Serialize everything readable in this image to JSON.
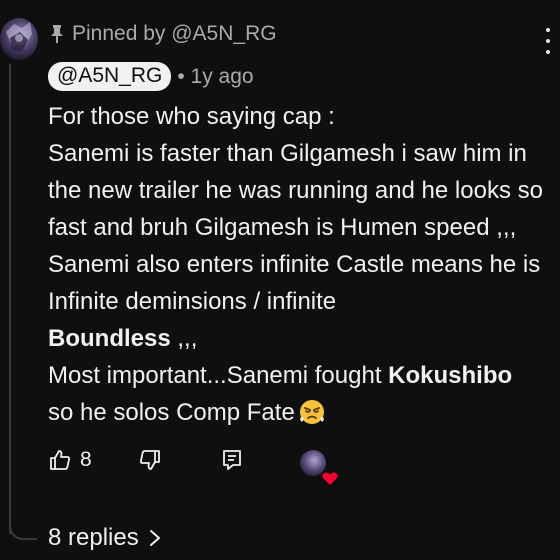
{
  "pinned": {
    "label": "Pinned by @A5N_RG",
    "icon": "pin-icon"
  },
  "comment": {
    "author": "@A5N_RG",
    "time": "• 1y ago",
    "lines": {
      "l1": "For those who saying cap :",
      "l2": "Sanemi is faster than Gilgamesh i saw him in the new trailer he was running and he looks so fast and bruh Gilgamesh is Humen speed ,,, Sanemi also enters infinite Castle means he is Infinite deminsions / infinite",
      "l3_bold": "Boundless",
      "l3_rest": " ,,,",
      "l4_start": "Most important...Sanemi fought ",
      "l4_bold": "Kokushibo",
      "l4_end": " so he solos Comp Fate"
    },
    "emoji": "huffing-face-emoji"
  },
  "actions": {
    "like_count": "8",
    "like_icon": "thumbs-up-icon",
    "dislike_icon": "thumbs-down-icon",
    "reply_icon": "reply-icon",
    "creator_heart": "creator-heart-icon"
  },
  "replies": {
    "label": "8 replies",
    "icon": "chevron-right-icon"
  },
  "colors": {
    "background": "#0f0f0f",
    "text": "#f1f1f1",
    "muted": "#aaaaaa",
    "heart": "#ff0033"
  }
}
